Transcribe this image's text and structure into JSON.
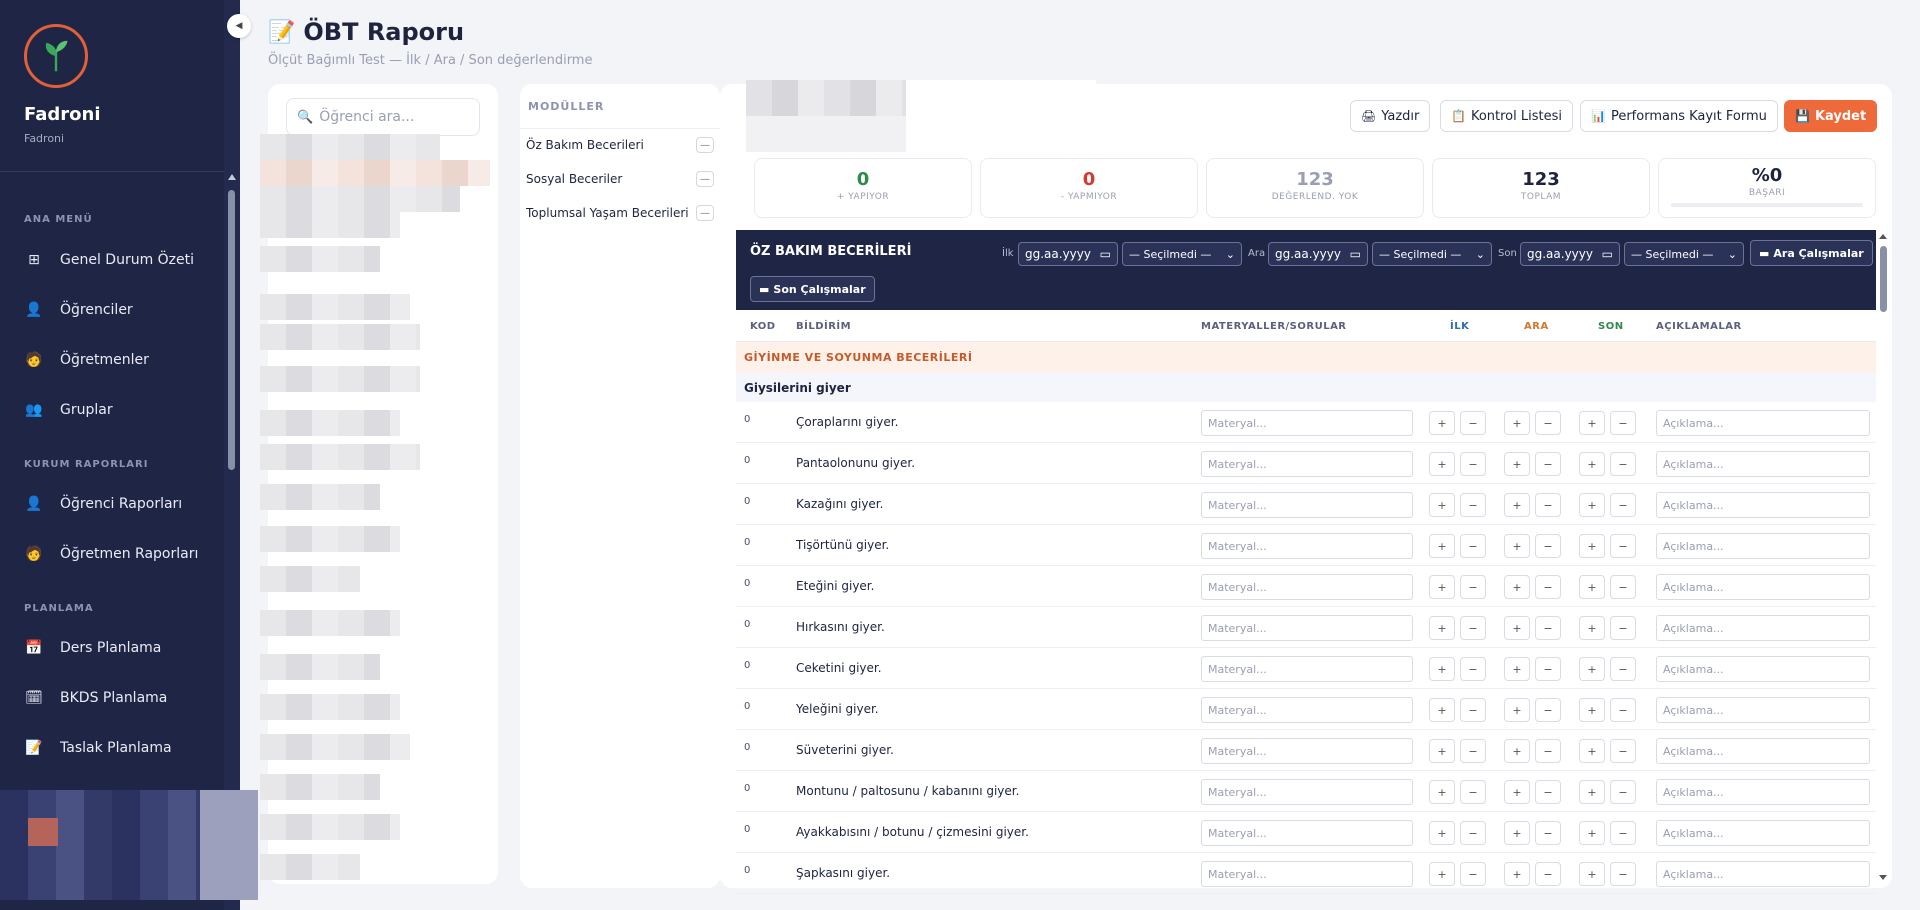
{
  "sidebar": {
    "brand": "Fadroni",
    "brand_sub": "Fadroni",
    "sections": [
      {
        "title": "ANA MENÜ",
        "items": [
          {
            "label": "Genel Durum Özeti",
            "icon": "grid-icon"
          },
          {
            "label": "Öğrenciler",
            "icon": "student-icon"
          },
          {
            "label": "Öğretmenler",
            "icon": "teacher-icon"
          },
          {
            "label": "Gruplar",
            "icon": "group-icon"
          }
        ]
      },
      {
        "title": "KURUM RAPORLARI",
        "items": [
          {
            "label": "Öğrenci Raporları",
            "icon": "student-report-icon"
          },
          {
            "label": "Öğretmen Raporları",
            "icon": "teacher-report-icon"
          }
        ]
      },
      {
        "title": "PLANLAMA",
        "items": [
          {
            "label": "Ders Planlama",
            "icon": "calendar-icon"
          },
          {
            "label": "BKDS Planlama",
            "icon": "bkds-icon"
          },
          {
            "label": "Taslak Planlama",
            "icon": "draft-icon"
          }
        ]
      }
    ]
  },
  "header": {
    "title": "ÖBT Raporu",
    "subtitle": "Ölçüt Bağımlı Test — İlk / Ara / Son değerlendirme"
  },
  "students": {
    "search_placeholder": "Öğrenci ara..."
  },
  "modules": {
    "title": "MODÜLLER",
    "items": [
      {
        "label": "Öz Bakım Becerileri",
        "badge": "—"
      },
      {
        "label": "Sosyal Beceriler",
        "badge": "—"
      },
      {
        "label": "Toplumsal Yaşam Becerileri",
        "badge": "—"
      }
    ]
  },
  "toolbar": {
    "print": "Yazdır",
    "checklist": "Kontrol Listesi",
    "performance": "Performans Kayıt Formu",
    "save": "Kaydet"
  },
  "stats": [
    {
      "value": "0",
      "label": "+ YAPIYOR",
      "color": "#2e8b4a"
    },
    {
      "value": "0",
      "label": "- YAPMIYOR",
      "color": "#d83a2e"
    },
    {
      "value": "123",
      "label": "DEĞERLEND. YOK",
      "color": "#9a9eb4"
    },
    {
      "value": "123",
      "label": "TOPLAM",
      "color": "#1e2340"
    },
    {
      "value": "%0",
      "label": "BAŞARI",
      "color": "#1e2340",
      "progress": 0
    }
  ],
  "section": {
    "title": "ÖZ BAKIM BECERİLERİ",
    "ilk_label": "İlk",
    "ara_label": "Ara",
    "son_label": "Son",
    "date_placeholder": "gg.aa.yyyy",
    "select_value": "— Seçilmedi —",
    "ara_btn": "Ara Çalışmalar",
    "son_btn": "Son Çalışmalar"
  },
  "table": {
    "headers": {
      "kod": "KOD",
      "bildirim": "BİLDİRİM",
      "materyal": "MATERYALLER/SORULAR",
      "ilk": "İLK",
      "ara": "ARA",
      "son": "SON",
      "aciklama": "AÇIKLAMALAR"
    },
    "header_colors": {
      "ilk": "#2a6fb0",
      "ara": "#d6762a",
      "son": "#2e8b4a"
    },
    "category": "GİYİNME VE SOYUNMA BECERİLERİ",
    "subcategory": "Giysilerini giyer",
    "material_placeholder": "Materyal...",
    "desc_placeholder": "Açıklama...",
    "plus": "+",
    "minus": "−",
    "rows": [
      {
        "kod": "0",
        "text": "Çoraplarını giyer."
      },
      {
        "kod": "0",
        "text": "Pantaolonunu giyer."
      },
      {
        "kod": "0",
        "text": "Kazağını giyer."
      },
      {
        "kod": "0",
        "text": "Tişörtünü giyer."
      },
      {
        "kod": "0",
        "text": "Eteğini giyer."
      },
      {
        "kod": "0",
        "text": "Hırkasını giyer."
      },
      {
        "kod": "0",
        "text": "Ceketini giyer."
      },
      {
        "kod": "0",
        "text": "Yeleğini giyer."
      },
      {
        "kod": "0",
        "text": "Süveterini giyer."
      },
      {
        "kod": "0",
        "text": "Montunu / paltosunu / kabanını giyer."
      },
      {
        "kod": "0",
        "text": "Ayakkabısını / botunu / çizmesini giyer."
      },
      {
        "kod": "0",
        "text": "Şapkasını giyer."
      }
    ]
  }
}
